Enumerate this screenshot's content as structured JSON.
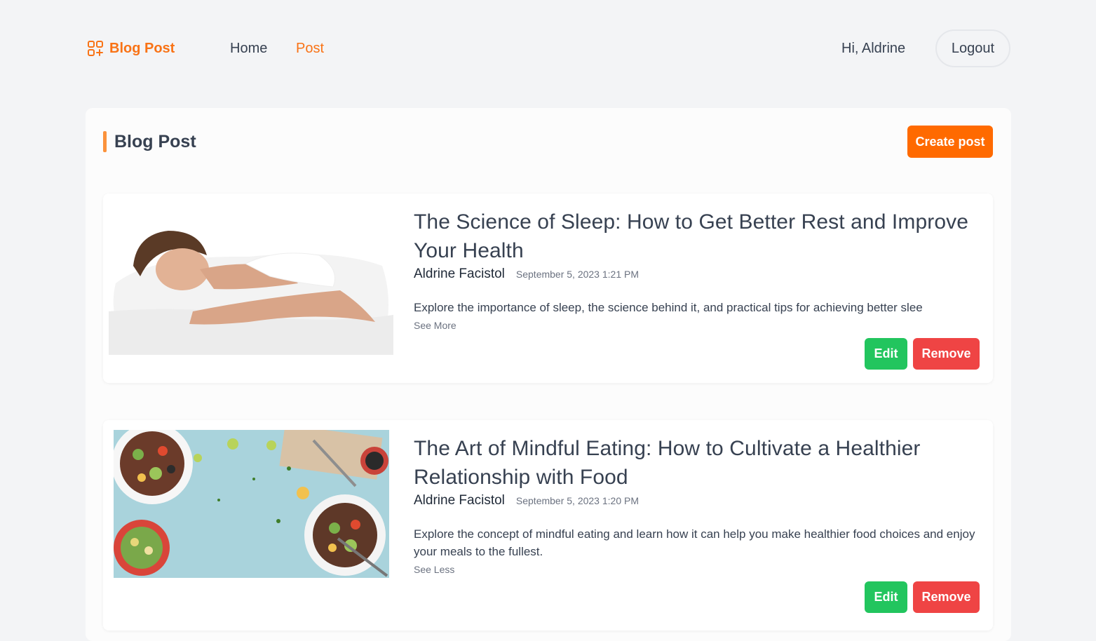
{
  "nav": {
    "brand": "Blog Post",
    "links": [
      {
        "label": "Home",
        "active": false
      },
      {
        "label": "Post",
        "active": true
      }
    ],
    "greeting": "Hi, Aldrine",
    "logout_label": "Logout"
  },
  "section": {
    "title": "Blog Post",
    "create_label": "Create post"
  },
  "posts": [
    {
      "title": "The Science of Sleep: How to Get Better Rest and Improve Your Health",
      "author": "Aldrine Facistol",
      "date": "September 5, 2023 1:21 PM",
      "excerpt": "Explore the importance of sleep, the science behind it, and practical tips for achieving better slee",
      "toggle_label": "See More",
      "image": "woman-sleeping-on-pillow",
      "edit_label": "Edit",
      "remove_label": "Remove"
    },
    {
      "title": "The Art of Mindful Eating: How to Cultivate a Healthier Relationship with Food",
      "author": "Aldrine Facistol",
      "date": "September 5, 2023 1:20 PM",
      "excerpt": "Explore the concept of mindful eating and learn how it can help you make healthier food choices and enjoy your meals to the fullest.",
      "toggle_label": "See Less",
      "image": "salad-bowls-on-blue-table",
      "edit_label": "Edit",
      "remove_label": "Remove"
    }
  ],
  "colors": {
    "accent": "#f97316",
    "create_button": "#ff6a00",
    "edit_button": "#22c55e",
    "remove_button": "#ef4444",
    "page_background": "#f3f4f6"
  }
}
